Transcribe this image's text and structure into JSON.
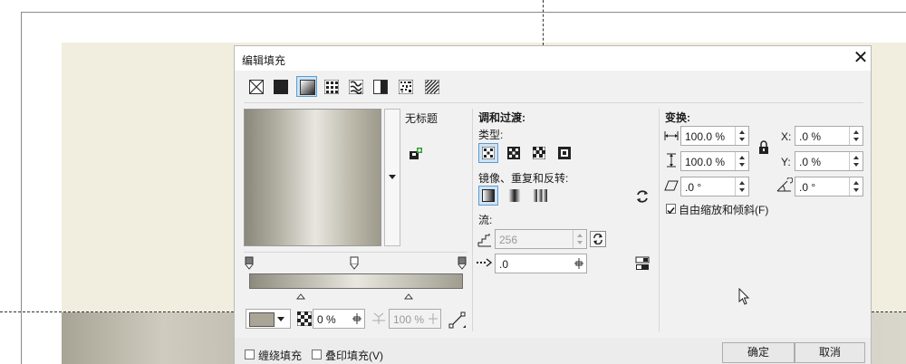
{
  "dialog": {
    "title": "编辑填充",
    "close_glyph": "✕"
  },
  "fill_types": [
    "no-fill-icon",
    "uniform-fill-icon",
    "fountain-fill-icon",
    "vector-pattern-icon",
    "bitmap-pattern-icon",
    "two-color-pattern-icon",
    "texture-fill-icon",
    "postscript-fill-icon"
  ],
  "preset": {
    "name": "无标题"
  },
  "blend": {
    "header": "调和过渡:",
    "type_label": "类型:",
    "mirror_label": "镜像、重复和反转:",
    "flow_label": "流:",
    "steps_value": "256",
    "accel_value": ".0"
  },
  "gradient": {
    "node_color": "#a9a697",
    "transparency_value": "0 %",
    "position_value": "100 %"
  },
  "transform": {
    "header": "变换:",
    "width_value": "100.0 %",
    "height_value": "100.0 %",
    "skew_value": ".0 °",
    "x_label": "X:",
    "x_value": ".0 %",
    "y_label": "Y:",
    "y_value": ".0 %",
    "rotate_value": ".0 °",
    "free_scale_label": "自由缩放和倾斜(F)",
    "free_scale_checked": true
  },
  "footer": {
    "wrap_fill_label": "缠绕填充",
    "overprint_label": "叠印填充(V)",
    "ok_label": "确定",
    "cancel_label": "取消"
  }
}
